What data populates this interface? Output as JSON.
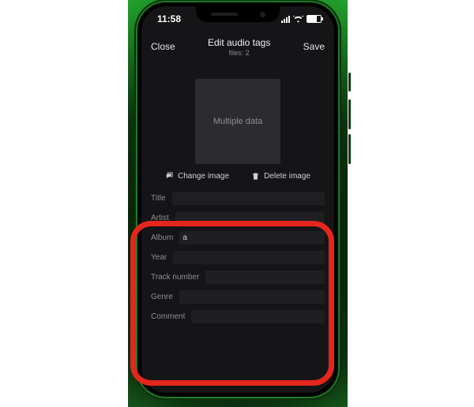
{
  "statusbar": {
    "time": "11:58"
  },
  "nav": {
    "close": "Close",
    "title": "Edit audio tags",
    "subtitle": "files: 2",
    "save": "Save"
  },
  "artwork": {
    "placeholder": "Multiple data"
  },
  "image_actions": {
    "change": "Change image",
    "delete": "Delete image"
  },
  "fields": {
    "title": {
      "label": "Title",
      "value": ""
    },
    "artist": {
      "label": "Artist",
      "value": ""
    },
    "album": {
      "label": "Album",
      "value": "a"
    },
    "year": {
      "label": "Year",
      "value": ""
    },
    "track_number": {
      "label": "Track number",
      "value": ""
    },
    "genre": {
      "label": "Genre",
      "value": ""
    },
    "comment": {
      "label": "Comment",
      "value": ""
    }
  }
}
